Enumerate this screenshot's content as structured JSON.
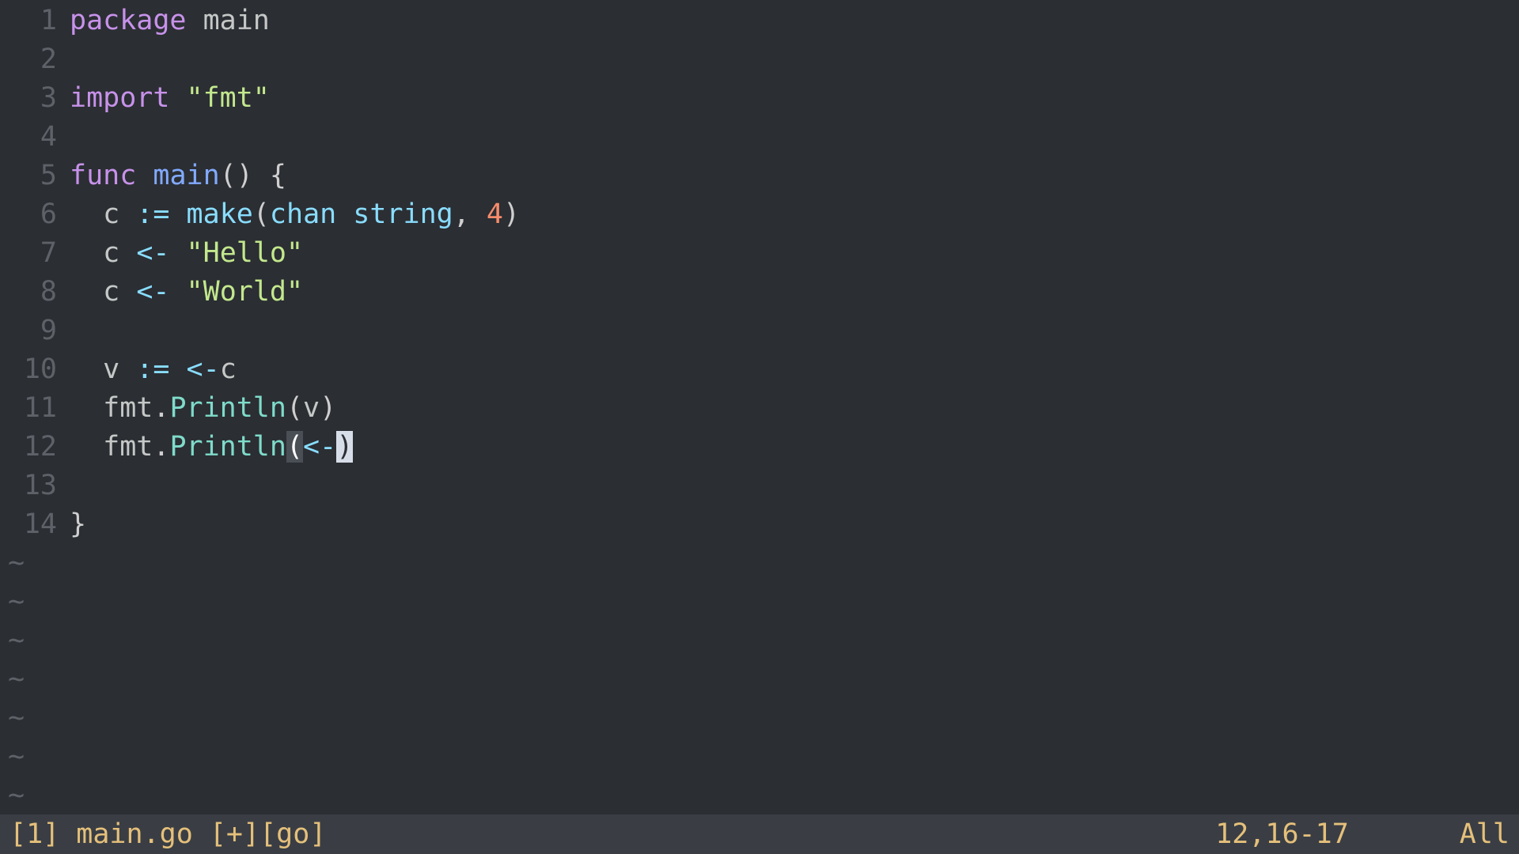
{
  "editor": {
    "tilde": "~",
    "tilde_count": 7,
    "lines": [
      {
        "num": "1",
        "tokens": [
          [
            "kw",
            "package"
          ],
          [
            "punc",
            " "
          ],
          [
            "ident",
            "main"
          ]
        ]
      },
      {
        "num": "2",
        "tokens": []
      },
      {
        "num": "3",
        "tokens": [
          [
            "kw",
            "import"
          ],
          [
            "punc",
            " "
          ],
          [
            "str",
            "\"fmt\""
          ]
        ]
      },
      {
        "num": "4",
        "tokens": []
      },
      {
        "num": "5",
        "tokens": [
          [
            "kw",
            "func"
          ],
          [
            "punc",
            " "
          ],
          [
            "name",
            "main"
          ],
          [
            "punc",
            "()"
          ],
          [
            "punc",
            " "
          ],
          [
            "punc",
            "{"
          ]
        ]
      },
      {
        "num": "6",
        "tokens": [
          [
            "punc",
            "  "
          ],
          [
            "ident",
            "c"
          ],
          [
            "punc",
            " "
          ],
          [
            "op",
            ":="
          ],
          [
            "punc",
            " "
          ],
          [
            "builtin",
            "make"
          ],
          [
            "punc",
            "("
          ],
          [
            "builtin",
            "chan"
          ],
          [
            "punc",
            " "
          ],
          [
            "builtin",
            "string"
          ],
          [
            "punc",
            ", "
          ],
          [
            "num",
            "4"
          ],
          [
            "punc",
            ")"
          ]
        ]
      },
      {
        "num": "7",
        "tokens": [
          [
            "punc",
            "  "
          ],
          [
            "ident",
            "c"
          ],
          [
            "punc",
            " "
          ],
          [
            "op",
            "<-"
          ],
          [
            "punc",
            " "
          ],
          [
            "str",
            "\"Hello\""
          ]
        ]
      },
      {
        "num": "8",
        "tokens": [
          [
            "punc",
            "  "
          ],
          [
            "ident",
            "c"
          ],
          [
            "punc",
            " "
          ],
          [
            "op",
            "<-"
          ],
          [
            "punc",
            " "
          ],
          [
            "str",
            "\"World\""
          ]
        ]
      },
      {
        "num": "9",
        "tokens": []
      },
      {
        "num": "10",
        "tokens": [
          [
            "punc",
            "  "
          ],
          [
            "ident",
            "v"
          ],
          [
            "punc",
            " "
          ],
          [
            "op",
            ":="
          ],
          [
            "punc",
            " "
          ],
          [
            "op",
            "<-"
          ],
          [
            "ident",
            "c"
          ]
        ]
      },
      {
        "num": "11",
        "tokens": [
          [
            "punc",
            "  "
          ],
          [
            "ident",
            "fmt"
          ],
          [
            "punc",
            "."
          ],
          [
            "teal",
            "Println"
          ],
          [
            "punc",
            "("
          ],
          [
            "ident",
            "v"
          ],
          [
            "punc",
            ")"
          ]
        ]
      },
      {
        "num": "12",
        "tokens": [
          [
            "punc",
            "  "
          ],
          [
            "ident",
            "fmt"
          ],
          [
            "punc",
            "."
          ],
          [
            "teal",
            "Println"
          ],
          [
            "match-paren",
            "("
          ],
          [
            "op",
            "<-"
          ],
          [
            "cursor",
            ")"
          ]
        ]
      },
      {
        "num": "13",
        "tokens": []
      },
      {
        "num": "14",
        "tokens": [
          [
            "punc",
            "}"
          ]
        ]
      }
    ]
  },
  "status": {
    "left": "[1] main.go [+][go]",
    "pos": "12,16-17",
    "right": "All"
  }
}
